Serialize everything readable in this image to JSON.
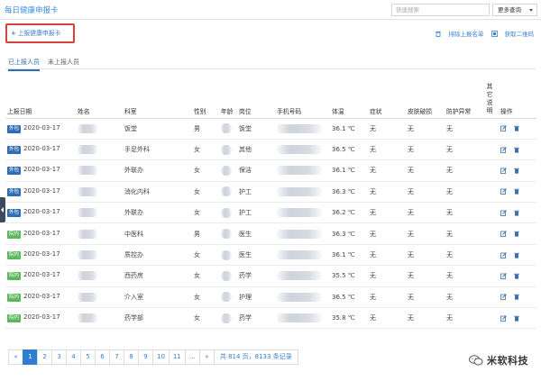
{
  "header": {
    "title": "每日健康申报卡",
    "search_placeholder": "快速搜索",
    "more_query": "更多查询"
  },
  "toolbar": {
    "report_label": "上报健康申报卡",
    "exclude_label": "排除上报名单",
    "qrcode_label": "获取二维码"
  },
  "tabs": [
    {
      "label": "已上报人员",
      "active": true
    },
    {
      "label": "未上报人员",
      "active": false
    }
  ],
  "table": {
    "headers": [
      "上报日期",
      "姓名",
      "科室",
      "性别",
      "年龄",
      "岗位",
      "手机号码",
      "体温",
      "症状",
      "皮肤破损",
      "防护异常",
      "其它说明",
      "操作"
    ],
    "rows": [
      {
        "badge": "外包",
        "badge_color": "#2e6db4",
        "date": "2020-03-17",
        "dept": "饭堂",
        "gender": "男",
        "post": "饭堂",
        "temp": "36.1 ℃",
        "symptom": "无",
        "skin": "无",
        "protect": "无"
      },
      {
        "badge": "外包",
        "badge_color": "#2e6db4",
        "date": "2020-03-17",
        "dept": "手足外科",
        "gender": "女",
        "post": "其他",
        "temp": "36.5 ℃",
        "symptom": "无",
        "skin": "无",
        "protect": "无"
      },
      {
        "badge": "外包",
        "badge_color": "#2e6db4",
        "date": "2020-03-17",
        "dept": "外联办",
        "gender": "女",
        "post": "保洁",
        "temp": "36.1 ℃",
        "symptom": "无",
        "skin": "无",
        "protect": "无"
      },
      {
        "badge": "外包",
        "badge_color": "#2e6db4",
        "date": "2020-03-17",
        "dept": "消化内科",
        "gender": "女",
        "post": "护工",
        "temp": "36.3 ℃",
        "symptom": "无",
        "skin": "无",
        "protect": "无"
      },
      {
        "badge": "外包",
        "badge_color": "#2e6db4",
        "date": "2020-03-17",
        "dept": "外联办",
        "gender": "女",
        "post": "护工",
        "temp": "36.2 ℃",
        "symptom": "无",
        "skin": "无",
        "protect": "无"
      },
      {
        "badge": "院内",
        "badge_color": "#5cb85c",
        "date": "2020-03-17",
        "dept": "中医科",
        "gender": "男",
        "post": "医生",
        "temp": "36.3 ℃",
        "symptom": "无",
        "skin": "无",
        "protect": "无"
      },
      {
        "badge": "院内",
        "badge_color": "#5cb85c",
        "date": "2020-03-17",
        "dept": "质控办",
        "gender": "女",
        "post": "医生",
        "temp": "36.1 ℃",
        "symptom": "无",
        "skin": "无",
        "protect": "无"
      },
      {
        "badge": "院内",
        "badge_color": "#5cb85c",
        "date": "2020-03-17",
        "dept": "西药房",
        "gender": "女",
        "post": "药学",
        "temp": "35.5 ℃",
        "symptom": "无",
        "skin": "无",
        "protect": "无"
      },
      {
        "badge": "院内",
        "badge_color": "#5cb85c",
        "date": "2020-03-17",
        "dept": "介入室",
        "gender": "女",
        "post": "护理",
        "temp": "36.5 ℃",
        "symptom": "无",
        "skin": "无",
        "protect": "无"
      },
      {
        "badge": "院内",
        "badge_color": "#5cb85c",
        "date": "2020-03-17",
        "dept": "药学部",
        "gender": "女",
        "post": "药学",
        "temp": "35.8 ℃",
        "symptom": "无",
        "skin": "无",
        "protect": "无"
      }
    ]
  },
  "pagination": {
    "prev": "«",
    "pages": [
      "1",
      "2",
      "3",
      "4",
      "5",
      "6",
      "7",
      "8",
      "9",
      "10",
      "11",
      "..."
    ],
    "next": "»",
    "info": "共 814 页，8133 条记录"
  },
  "watermark": "米软科技",
  "colors": {
    "accent": "#3a7ed0",
    "highlight_border": "#d9413b",
    "badge_outsource": "#2e6db4",
    "badge_internal": "#5cb85c"
  }
}
